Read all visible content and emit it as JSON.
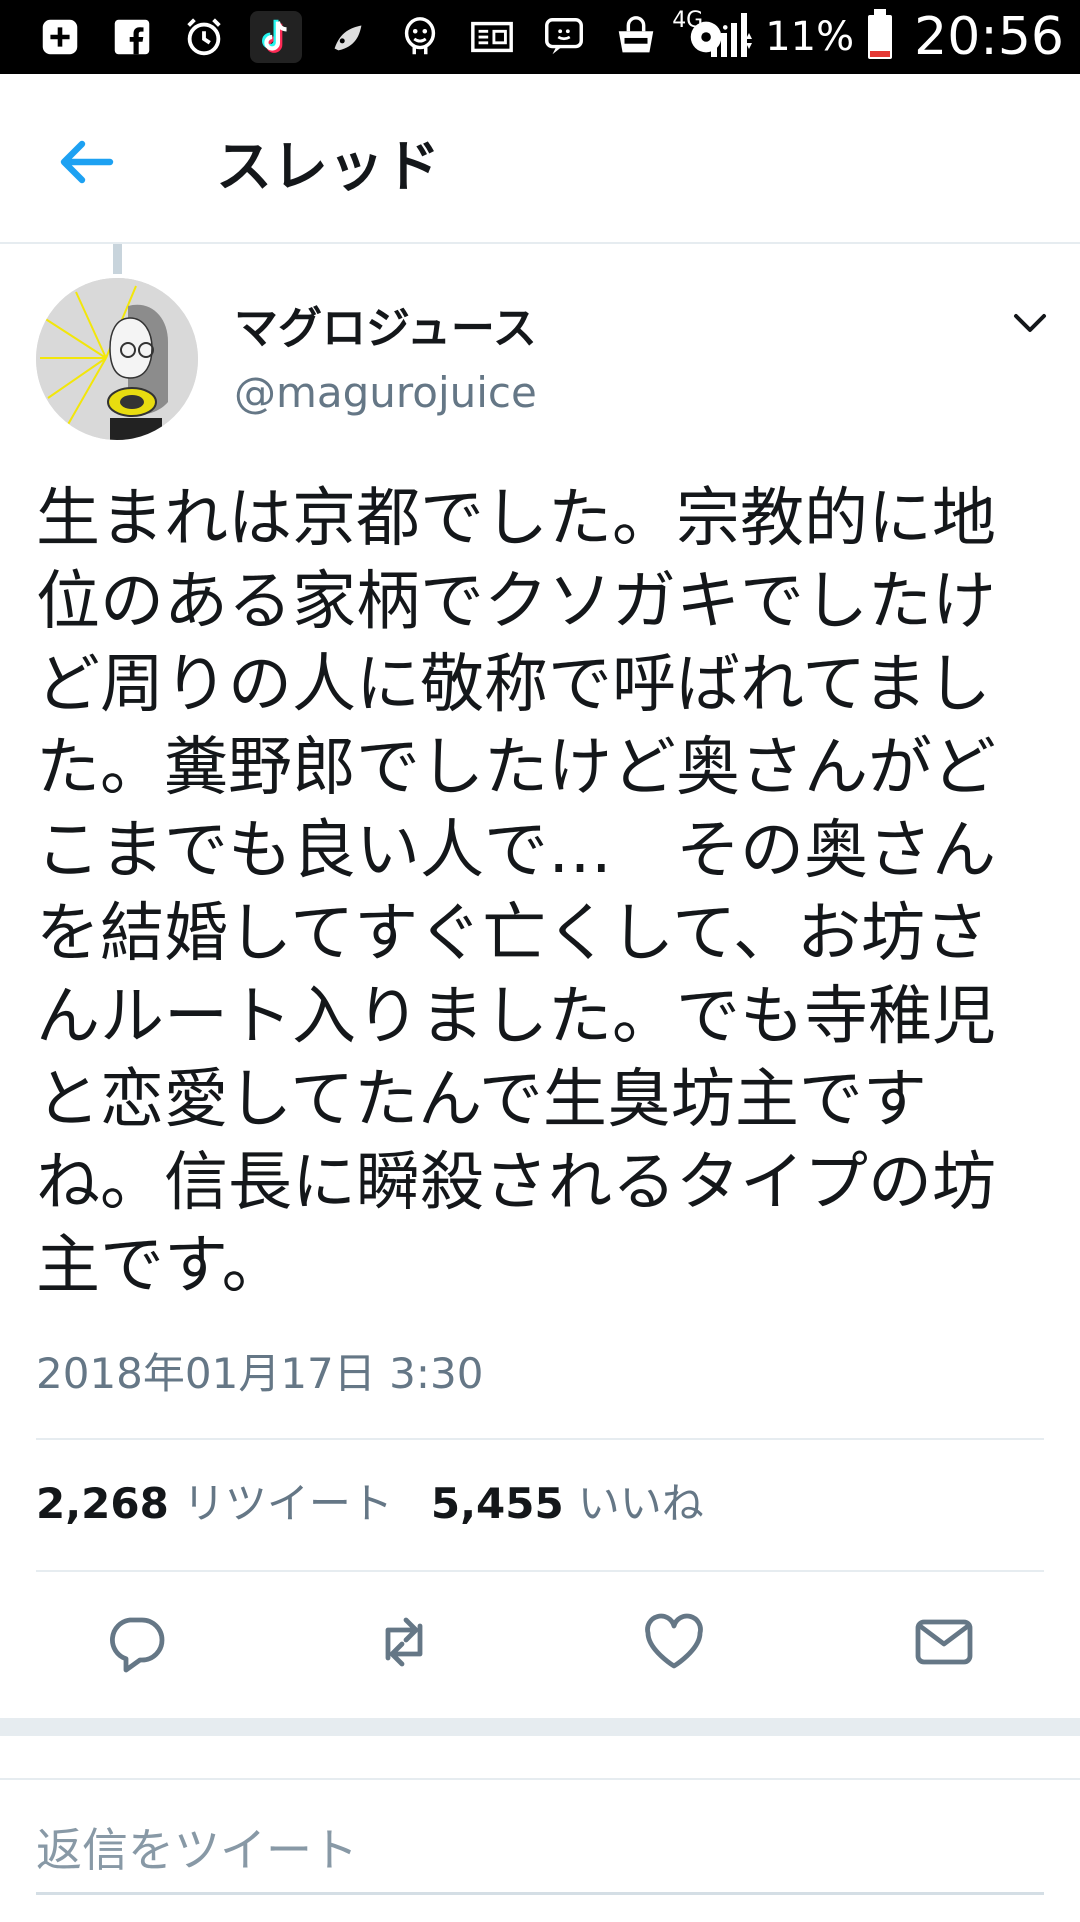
{
  "status_bar": {
    "icons": [
      "plus-box-icon",
      "facebook-icon",
      "alarm-icon",
      "tiktok-icon",
      "leaf-icon",
      "cartoon-icon",
      "news-icon",
      "chat-icon",
      "market-icon",
      "disk-icon"
    ],
    "network": "4G",
    "battery_percent": "11%",
    "time": "20:56"
  },
  "header": {
    "title": "スレッド"
  },
  "tweet": {
    "display_name": "マグロジュース",
    "handle": "@magurojuice",
    "text": "生まれは京都でした。宗教的に地位のある家柄でクソガキでしたけど周りの人に敬称で呼ばれてました。糞野郎でしたけど奥さんがどこまでも良い人で…　その奥さんを結婚してすぐ亡くして、お坊さんルート入りました。でも寺稚児と恋愛してたんで生臭坊主ですね。信長に瞬殺されるタイプの坊主です。",
    "timestamp": "2018年01月17日 3:30",
    "retweet_count": "2,268",
    "retweet_label": "リツイート",
    "like_count": "5,455",
    "like_label": "いいね"
  },
  "reply": {
    "placeholder": "返信をツイート"
  },
  "colors": {
    "accent": "#1da1f2",
    "secondary_text": "#657786",
    "action_icon": "#657786"
  }
}
